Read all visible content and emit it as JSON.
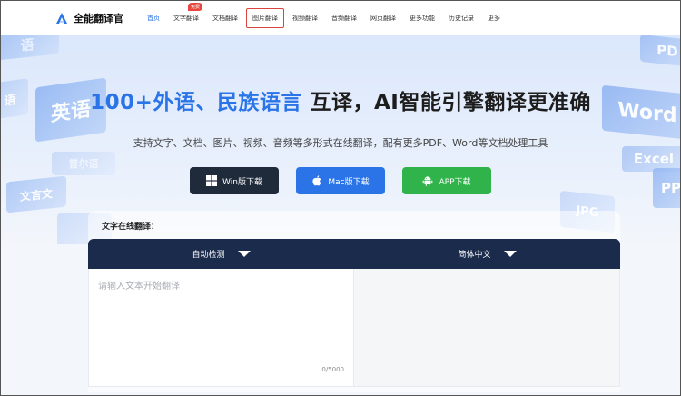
{
  "brand": {
    "name": "全能翻译官",
    "logo_icon": "a-logo-icon",
    "logo_color": "#2a74e8"
  },
  "nav": {
    "items": [
      {
        "label": "首页",
        "active": true
      },
      {
        "label": "文字翻译",
        "badge": "免费"
      },
      {
        "label": "文档翻译"
      },
      {
        "label": "图片翻译",
        "highlighted": true
      },
      {
        "label": "视频翻译"
      },
      {
        "label": "音频翻译"
      },
      {
        "label": "网页翻译"
      },
      {
        "label": "更多功能"
      },
      {
        "label": "历史记录"
      },
      {
        "label": "更多"
      }
    ]
  },
  "hero": {
    "title_highlight": "100+外语、民族语言",
    "title_rest": " 互译，AI智能引擎翻译更准确",
    "subtitle": "支持文字、文档、图片、视频、音频等多形式在线翻译，配有更多PDF、Word等文档处理工具",
    "bg_tiles": [
      "语",
      "英语",
      "语",
      "普尔语",
      "文言文",
      "",
      "PD",
      "Word",
      "Excel",
      "PP",
      "JPG"
    ],
    "downloads": [
      {
        "label": "Win版下载",
        "icon": "windows-icon",
        "color": "#1f2a3a"
      },
      {
        "label": "Mac版下载",
        "icon": "apple-icon",
        "color": "#2a74e8"
      },
      {
        "label": "APP下载",
        "icon": "android-icon",
        "color": "#2fb34a"
      }
    ]
  },
  "translator": {
    "section_label": "文字在线翻译：",
    "source_lang": "自动检测",
    "target_lang": "简体中文",
    "input_placeholder": "请输入文本开始翻译",
    "char_count": "0/5000"
  }
}
